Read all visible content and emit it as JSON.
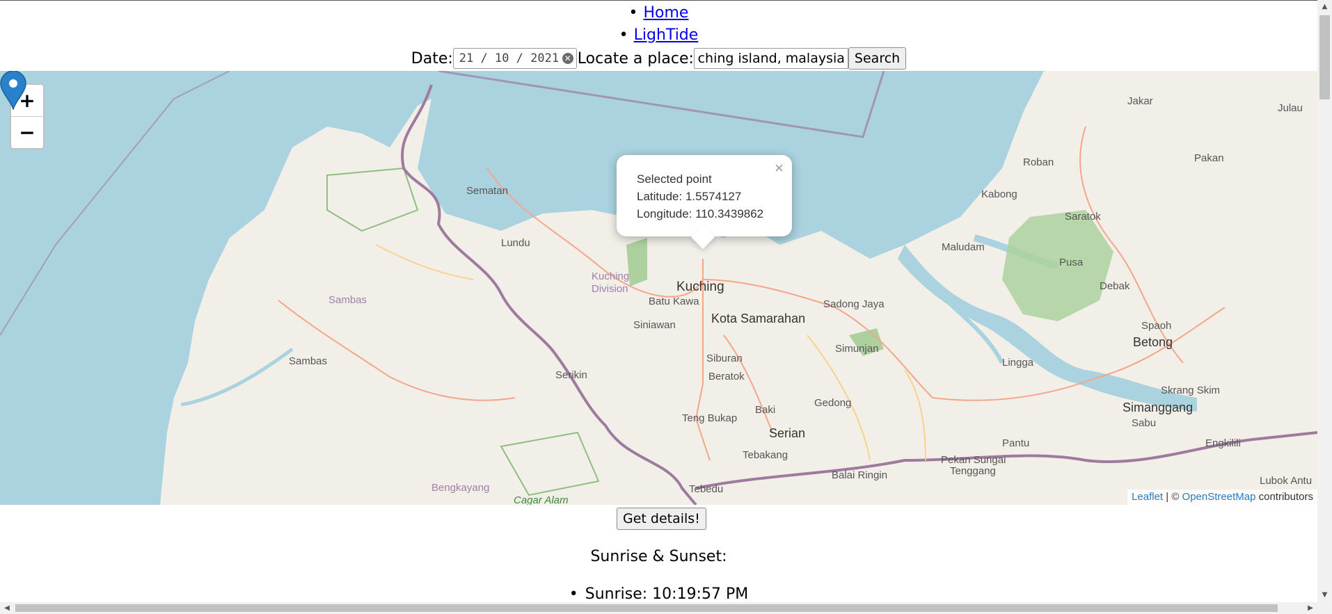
{
  "nav": {
    "home": "Home",
    "lightide": "LighTide"
  },
  "search": {
    "date_label": "Date:",
    "date_value": "21 / 10 / 2021",
    "place_label": "Locate a place:",
    "place_value": "kuching island, malaysia",
    "search_button": "Search"
  },
  "map": {
    "zoom_in": "+",
    "zoom_out": "−",
    "popup": {
      "title": "Selected point",
      "latitude": "Latitude: 1.5574127",
      "longitude": "Longitude: 110.3439862",
      "close": "×"
    },
    "attribution": {
      "leaflet": "Leaflet",
      "sep": " | © ",
      "osm": "OpenStreetMap",
      "suffix": " contributors"
    },
    "places": [
      "Sematan",
      "Lundu",
      "Kuching Division",
      "Sambas",
      "Sambas",
      "Kuching",
      "Batu Kawa",
      "Siniawan",
      "Kota Samarahan",
      "Siburan",
      "Beratok",
      "Serikin",
      "Teng Bukap",
      "Baki",
      "Serian",
      "Tebakang",
      "Tebedu",
      "Bengkayang",
      "Cagar Alam",
      "Sadong Jaya",
      "Simunjan",
      "Gedong",
      "Balai Ringin",
      "Kabong",
      "Roban",
      "Saratok",
      "Maludam",
      "Pusa",
      "Debak",
      "Jakar",
      "Julau",
      "Pakan",
      "Spaoh",
      "Betong",
      "Lingga",
      "Skrang Skim",
      "Simanggang",
      "Sabu",
      "Pantu",
      "Pekan Sungai Tenggang",
      "Engkilili",
      "Lubok Antu"
    ],
    "colors": {
      "sea": "#aad3df",
      "land": "#f2efe9",
      "forest": "#add19e",
      "road": "#f4a58a",
      "border": "#9e7a9e"
    }
  },
  "details_button": "Get details!",
  "section_heading": "Sunrise & Sunset:",
  "sunrise": "Sunrise: 10:19:57 PM"
}
